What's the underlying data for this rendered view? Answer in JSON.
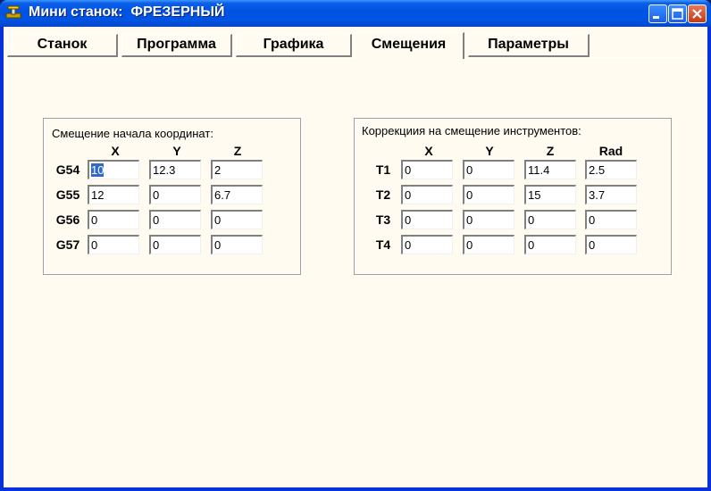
{
  "window": {
    "title": "Мини станок:  ФРЕЗЕРНЫЙ",
    "icon": "cnc-app-icon",
    "buttons": [
      "minimize",
      "maximize",
      "close"
    ]
  },
  "tabs": [
    {
      "label": "Станок"
    },
    {
      "label": "Программа"
    },
    {
      "label": "Графика"
    },
    {
      "label": "Смещения",
      "active": true
    },
    {
      "label": "Параметры"
    }
  ],
  "offsets": {
    "title": "Смещение начала координат:",
    "columns": [
      "X",
      "Y",
      "Z"
    ],
    "rows": [
      {
        "label": "G54",
        "values": [
          "10",
          "12.3",
          "2"
        ]
      },
      {
        "label": "G55",
        "values": [
          "12",
          "0",
          "6.7"
        ]
      },
      {
        "label": "G56",
        "values": [
          "0",
          "0",
          "0"
        ]
      },
      {
        "label": "G57",
        "values": [
          "0",
          "0",
          "0"
        ]
      }
    ]
  },
  "tool_offsets": {
    "title": "Коррекциия на смещение инструментов:",
    "columns": [
      "X",
      "Y",
      "Z",
      "Rad"
    ],
    "rows": [
      {
        "label": "T1",
        "values": [
          "0",
          "0",
          "11.4",
          "2.5"
        ]
      },
      {
        "label": "T2",
        "values": [
          "0",
          "0",
          "15",
          "3.7"
        ]
      },
      {
        "label": "T3",
        "values": [
          "0",
          "0",
          "0",
          "0"
        ]
      },
      {
        "label": "T4",
        "values": [
          "0",
          "0",
          "0",
          "0"
        ]
      }
    ]
  },
  "colors": {
    "titlebar": "#0054e3",
    "client_bg": "#fffbf0",
    "selection": "#316ac5"
  }
}
